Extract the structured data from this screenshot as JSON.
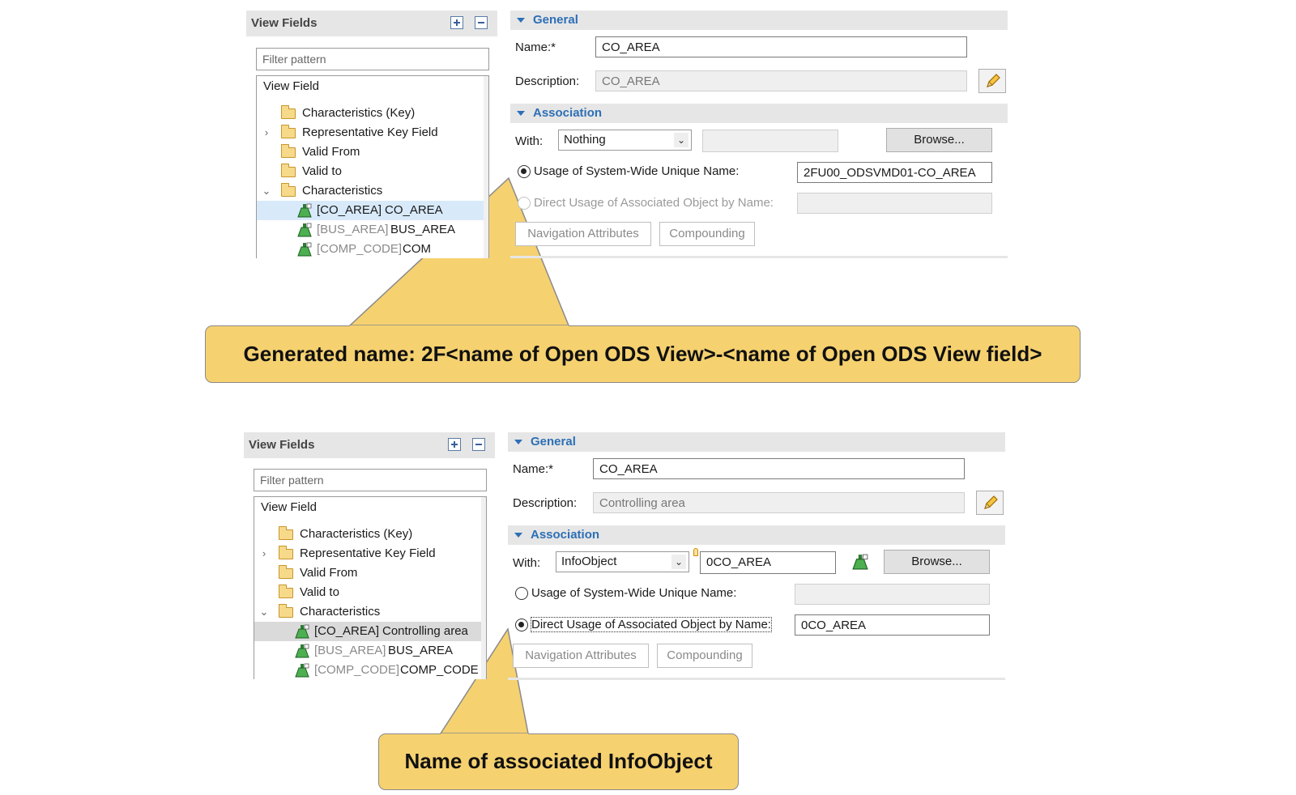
{
  "top": {
    "panel_title": "View Fields",
    "filter_placeholder": "Filter pattern",
    "tree_title": "View Field",
    "tree": {
      "key": "Characteristics (Key)",
      "rep": "Representative Key Field",
      "valid_from": "Valid From",
      "valid_to": "Valid to",
      "chars": "Characteristics",
      "f1_key": "[CO_AREA]",
      "f1_name": "CO_AREA",
      "f2_key": "[BUS_AREA]",
      "f2_name": "BUS_AREA",
      "f3_key": "[COMP_CODE]",
      "f3_name": "COM"
    },
    "general_label": "General",
    "name_label": "Name:*",
    "name_value": "CO_AREA",
    "desc_label": "Description:",
    "desc_value": "CO_AREA",
    "association_label": "Association",
    "with_label": "With:",
    "with_value": "Nothing",
    "assoc_value": "",
    "browse_label": "Browse...",
    "radio1_label": "Usage of System-Wide Unique Name:",
    "radio1_value": "2FU00_ODSVMD01-CO_AREA",
    "radio2_label": "Direct Usage of Associated Object by Name:",
    "radio2_value": "",
    "nav_label": "Navigation Attributes",
    "comp_label": "Compounding"
  },
  "bottom": {
    "panel_title": "View Fields",
    "filter_placeholder": "Filter pattern",
    "tree_title": "View Field",
    "tree": {
      "key": "Characteristics (Key)",
      "rep": "Representative Key Field",
      "valid_from": "Valid From",
      "valid_to": "Valid to",
      "chars": "Characteristics",
      "f1_key": "[CO_AREA]",
      "f1_name": "Controlling area",
      "f2_key": "[BUS_AREA]",
      "f2_name": "BUS_AREA",
      "f3_key": "[COMP_CODE]",
      "f3_name": "COMP_CODE"
    },
    "general_label": "General",
    "name_label": "Name:*",
    "name_value": "CO_AREA",
    "desc_label": "Description:",
    "desc_value": "Controlling area",
    "association_label": "Association",
    "with_label": "With:",
    "with_value": "InfoObject",
    "assoc_value": "0CO_AREA",
    "browse_label": "Browse...",
    "radio1_label": "Usage of System-Wide Unique Name:",
    "radio1_value": "",
    "radio2_label": "Direct Usage of Associated Object by Name:",
    "radio2_value": "0CO_AREA",
    "nav_label": "Navigation Attributes",
    "comp_label": "Compounding"
  },
  "callouts": {
    "top_text": "Generated name: 2F<name of Open ODS View>-<name of Open ODS View field>",
    "bottom_text": "Name of associated InfoObject"
  },
  "colors": {
    "callout_fill": "#f5d170",
    "section_header": "#2d6fb6"
  }
}
